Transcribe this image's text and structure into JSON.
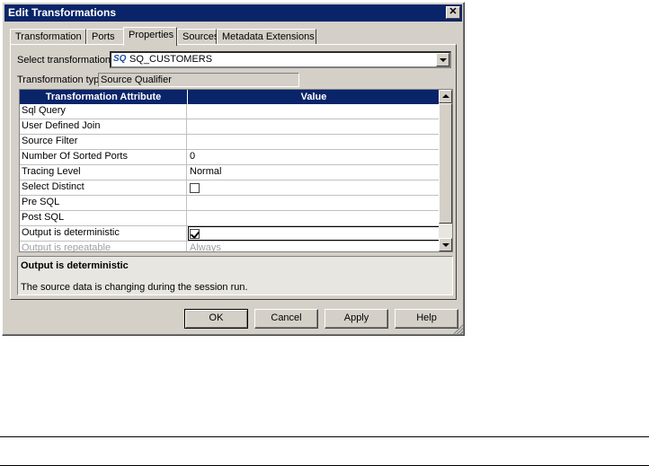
{
  "window": {
    "title": "Edit Transformations",
    "close_glyph": "✕"
  },
  "tabs": [
    {
      "label": "Transformation"
    },
    {
      "label": "Ports"
    },
    {
      "label": "Properties",
      "active": true
    },
    {
      "label": "Sources"
    },
    {
      "label": "Metadata Extensions"
    }
  ],
  "form": {
    "select_label": "Select transformation:",
    "select_icon": "SQ",
    "select_value": "SQ_CUSTOMERS",
    "type_label": "Transformation type:",
    "type_value": "Source Qualifier"
  },
  "table": {
    "headers": [
      "Transformation Attribute",
      "Value"
    ],
    "rows": [
      {
        "attr": "Sql Query",
        "value": ""
      },
      {
        "attr": "User Defined Join",
        "value": ""
      },
      {
        "attr": "Source Filter",
        "value": ""
      },
      {
        "attr": "Number Of Sorted Ports",
        "value": "0"
      },
      {
        "attr": "Tracing Level",
        "value": "Normal"
      },
      {
        "attr": "Select Distinct",
        "checkbox": false
      },
      {
        "attr": "Pre SQL",
        "value": ""
      },
      {
        "attr": "Post SQL",
        "value": ""
      },
      {
        "attr": "Output is deterministic",
        "checkbox": true
      },
      {
        "attr": "Output is repeatable",
        "value": "Always"
      }
    ]
  },
  "description": {
    "title": "Output is deterministic",
    "body": "The source data is changing during the session run."
  },
  "buttons": {
    "ok": "OK",
    "cancel": "Cancel",
    "apply": "Apply",
    "help": "Help"
  }
}
